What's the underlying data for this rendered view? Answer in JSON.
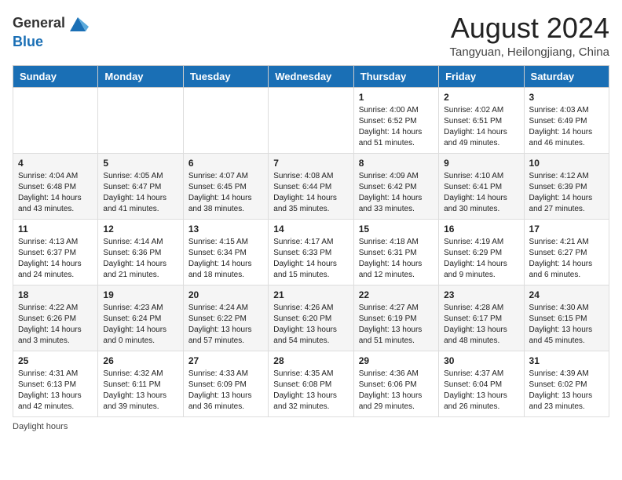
{
  "header": {
    "logo_line1": "General",
    "logo_line2": "Blue",
    "month_year": "August 2024",
    "location": "Tangyuan, Heilongjiang, China"
  },
  "weekdays": [
    "Sunday",
    "Monday",
    "Tuesday",
    "Wednesday",
    "Thursday",
    "Friday",
    "Saturday"
  ],
  "weeks": [
    [
      {
        "day": "",
        "detail": ""
      },
      {
        "day": "",
        "detail": ""
      },
      {
        "day": "",
        "detail": ""
      },
      {
        "day": "",
        "detail": ""
      },
      {
        "day": "1",
        "detail": "Sunrise: 4:00 AM\nSunset: 6:52 PM\nDaylight: 14 hours\nand 51 minutes."
      },
      {
        "day": "2",
        "detail": "Sunrise: 4:02 AM\nSunset: 6:51 PM\nDaylight: 14 hours\nand 49 minutes."
      },
      {
        "day": "3",
        "detail": "Sunrise: 4:03 AM\nSunset: 6:49 PM\nDaylight: 14 hours\nand 46 minutes."
      }
    ],
    [
      {
        "day": "4",
        "detail": "Sunrise: 4:04 AM\nSunset: 6:48 PM\nDaylight: 14 hours\nand 43 minutes."
      },
      {
        "day": "5",
        "detail": "Sunrise: 4:05 AM\nSunset: 6:47 PM\nDaylight: 14 hours\nand 41 minutes."
      },
      {
        "day": "6",
        "detail": "Sunrise: 4:07 AM\nSunset: 6:45 PM\nDaylight: 14 hours\nand 38 minutes."
      },
      {
        "day": "7",
        "detail": "Sunrise: 4:08 AM\nSunset: 6:44 PM\nDaylight: 14 hours\nand 35 minutes."
      },
      {
        "day": "8",
        "detail": "Sunrise: 4:09 AM\nSunset: 6:42 PM\nDaylight: 14 hours\nand 33 minutes."
      },
      {
        "day": "9",
        "detail": "Sunrise: 4:10 AM\nSunset: 6:41 PM\nDaylight: 14 hours\nand 30 minutes."
      },
      {
        "day": "10",
        "detail": "Sunrise: 4:12 AM\nSunset: 6:39 PM\nDaylight: 14 hours\nand 27 minutes."
      }
    ],
    [
      {
        "day": "11",
        "detail": "Sunrise: 4:13 AM\nSunset: 6:37 PM\nDaylight: 14 hours\nand 24 minutes."
      },
      {
        "day": "12",
        "detail": "Sunrise: 4:14 AM\nSunset: 6:36 PM\nDaylight: 14 hours\nand 21 minutes."
      },
      {
        "day": "13",
        "detail": "Sunrise: 4:15 AM\nSunset: 6:34 PM\nDaylight: 14 hours\nand 18 minutes."
      },
      {
        "day": "14",
        "detail": "Sunrise: 4:17 AM\nSunset: 6:33 PM\nDaylight: 14 hours\nand 15 minutes."
      },
      {
        "day": "15",
        "detail": "Sunrise: 4:18 AM\nSunset: 6:31 PM\nDaylight: 14 hours\nand 12 minutes."
      },
      {
        "day": "16",
        "detail": "Sunrise: 4:19 AM\nSunset: 6:29 PM\nDaylight: 14 hours\nand 9 minutes."
      },
      {
        "day": "17",
        "detail": "Sunrise: 4:21 AM\nSunset: 6:27 PM\nDaylight: 14 hours\nand 6 minutes."
      }
    ],
    [
      {
        "day": "18",
        "detail": "Sunrise: 4:22 AM\nSunset: 6:26 PM\nDaylight: 14 hours\nand 3 minutes."
      },
      {
        "day": "19",
        "detail": "Sunrise: 4:23 AM\nSunset: 6:24 PM\nDaylight: 14 hours\nand 0 minutes."
      },
      {
        "day": "20",
        "detail": "Sunrise: 4:24 AM\nSunset: 6:22 PM\nDaylight: 13 hours\nand 57 minutes."
      },
      {
        "day": "21",
        "detail": "Sunrise: 4:26 AM\nSunset: 6:20 PM\nDaylight: 13 hours\nand 54 minutes."
      },
      {
        "day": "22",
        "detail": "Sunrise: 4:27 AM\nSunset: 6:19 PM\nDaylight: 13 hours\nand 51 minutes."
      },
      {
        "day": "23",
        "detail": "Sunrise: 4:28 AM\nSunset: 6:17 PM\nDaylight: 13 hours\nand 48 minutes."
      },
      {
        "day": "24",
        "detail": "Sunrise: 4:30 AM\nSunset: 6:15 PM\nDaylight: 13 hours\nand 45 minutes."
      }
    ],
    [
      {
        "day": "25",
        "detail": "Sunrise: 4:31 AM\nSunset: 6:13 PM\nDaylight: 13 hours\nand 42 minutes."
      },
      {
        "day": "26",
        "detail": "Sunrise: 4:32 AM\nSunset: 6:11 PM\nDaylight: 13 hours\nand 39 minutes."
      },
      {
        "day": "27",
        "detail": "Sunrise: 4:33 AM\nSunset: 6:09 PM\nDaylight: 13 hours\nand 36 minutes."
      },
      {
        "day": "28",
        "detail": "Sunrise: 4:35 AM\nSunset: 6:08 PM\nDaylight: 13 hours\nand 32 minutes."
      },
      {
        "day": "29",
        "detail": "Sunrise: 4:36 AM\nSunset: 6:06 PM\nDaylight: 13 hours\nand 29 minutes."
      },
      {
        "day": "30",
        "detail": "Sunrise: 4:37 AM\nSunset: 6:04 PM\nDaylight: 13 hours\nand 26 minutes."
      },
      {
        "day": "31",
        "detail": "Sunrise: 4:39 AM\nSunset: 6:02 PM\nDaylight: 13 hours\nand 23 minutes."
      }
    ]
  ],
  "footer": {
    "note": "Daylight hours"
  }
}
